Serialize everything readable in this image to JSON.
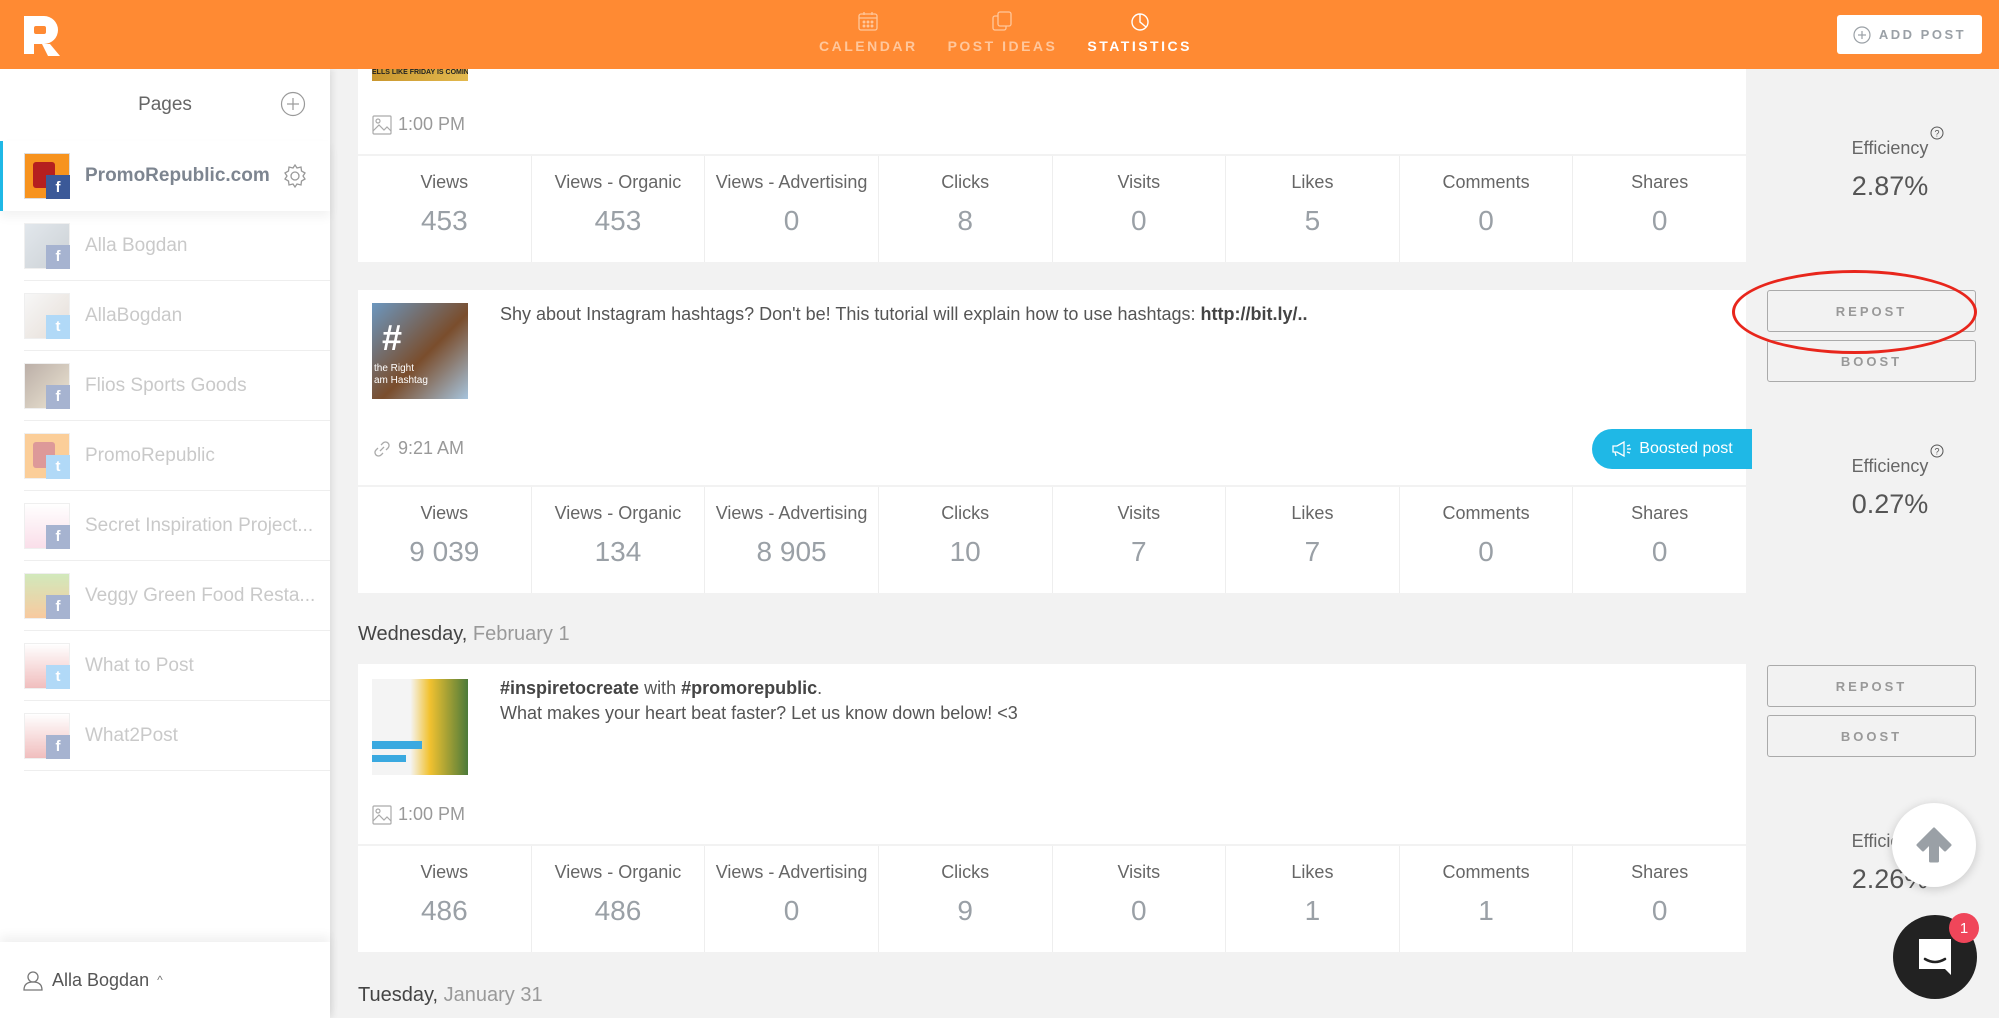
{
  "header": {
    "logo": "PromoRepublic logo",
    "nav": [
      {
        "label": "CALENDAR",
        "icon": "calendar-icon",
        "active": false
      },
      {
        "label": "POST IDEAS",
        "icon": "copy-icon",
        "active": false
      },
      {
        "label": "STATISTICS",
        "icon": "pie-chart-icon",
        "active": true
      }
    ],
    "add_post_label": "ADD POST"
  },
  "sidebar": {
    "title": "Pages",
    "pages": [
      {
        "name": "PromoRepublic.com",
        "network": "facebook",
        "active": true
      },
      {
        "name": "Alla Bogdan",
        "network": "facebook",
        "active": false
      },
      {
        "name": "AllaBogdan",
        "network": "twitter",
        "active": false
      },
      {
        "name": "Flios Sports Goods",
        "network": "facebook",
        "active": false
      },
      {
        "name": "PromoRepublic",
        "network": "twitter",
        "active": false
      },
      {
        "name": "Secret Inspiration Project...",
        "network": "facebook",
        "active": false
      },
      {
        "name": "Veggy Green Food Resta...",
        "network": "facebook",
        "active": false
      },
      {
        "name": "What to Post",
        "network": "twitter",
        "active": false
      },
      {
        "name": "What2Post",
        "network": "facebook",
        "active": false
      }
    ],
    "user_name": "Alla Bogdan"
  },
  "stat_labels": [
    "Views",
    "Views - Organic",
    "Views - Advertising",
    "Clicks",
    "Visits",
    "Likes",
    "Comments",
    "Shares"
  ],
  "posts": [
    {
      "thumb_text": "ELLS LIKE FRIDAY IS COMIN",
      "time": "1:00 PM",
      "time_icon": "image-icon",
      "stats": [
        "453",
        "453",
        "0",
        "8",
        "0",
        "5",
        "0",
        "0"
      ],
      "efficiency_label": "Efficiency",
      "efficiency": "2.87%"
    },
    {
      "text": "Shy about Instagram hashtags? Don't be! This tutorial will explain how to use hashtags: ",
      "link": "http://bit.ly/..",
      "thumb_text": "the Right\nam Hashtag",
      "time": "9:21 AM",
      "time_icon": "link-icon",
      "boosted_label": "Boosted post",
      "repost_label": "REPOST",
      "boost_label": "BOOST",
      "stats": [
        "9 039",
        "134",
        "8 905",
        "10",
        "7",
        "7",
        "0",
        "0"
      ],
      "efficiency_label": "Efficiency",
      "efficiency": "0.27%"
    },
    {
      "date_day": "Wednesday,",
      "date_rest": "February 1",
      "hashtag1": "#inspiretocreate",
      "with_text": " with ",
      "hashtag2": "#promorepublic",
      "period": ".",
      "text_line2": "What makes your heart beat faster? Let us know down below! <3",
      "time": "1:00 PM",
      "time_icon": "image-icon",
      "repost_label": "REPOST",
      "boost_label": "BOOST",
      "stats": [
        "486",
        "486",
        "0",
        "9",
        "0",
        "1",
        "1",
        "0"
      ],
      "efficiency_label": "Efficiency",
      "efficiency": "2.26%"
    }
  ],
  "next_date": {
    "day": "Tuesday,",
    "rest": "January 31"
  },
  "chat_badge_count": "1",
  "colors": {
    "brand": "#ff8a33",
    "accent": "#1fb8e6",
    "annotation": "#e8261c",
    "badge": "#f0465a"
  }
}
